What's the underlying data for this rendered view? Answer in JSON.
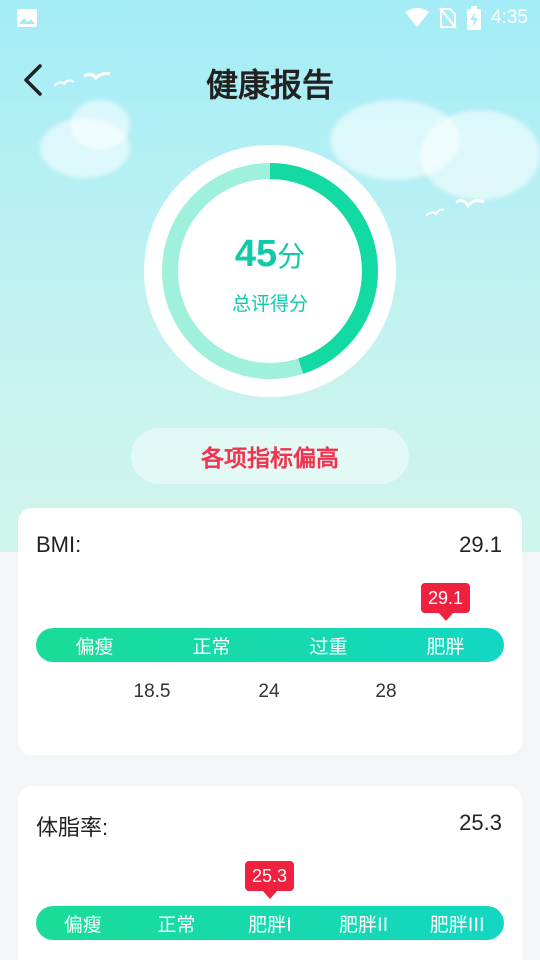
{
  "status_bar": {
    "time": "4:35",
    "icons": [
      "image-icon",
      "wifi-icon",
      "no-sim-icon",
      "battery-charging-icon"
    ]
  },
  "header": {
    "title": "健康报告",
    "back_icon": "chevron-left-icon"
  },
  "score": {
    "value": "45",
    "unit": "分",
    "label": "总评得分",
    "progress": 0.45
  },
  "verdict": "各项指标偏高",
  "bmi_card": {
    "label": "BMI:",
    "value": "29.1",
    "marker": "29.1",
    "categories": [
      "偏瘦",
      "正常",
      "过重",
      "肥胖"
    ],
    "thresholds": [
      "18.5",
      "24",
      "28"
    ]
  },
  "body_fat_card": {
    "label": "体脂率:",
    "value": "25.3",
    "marker": "25.3",
    "categories": [
      "偏瘦",
      "正常",
      "肥胖I",
      "肥胖II",
      "肥胖III"
    ]
  },
  "colors": {
    "accent_green": "#13d9a3",
    "ring_light": "#9ff0dc",
    "alert_red": "#f0213e"
  }
}
